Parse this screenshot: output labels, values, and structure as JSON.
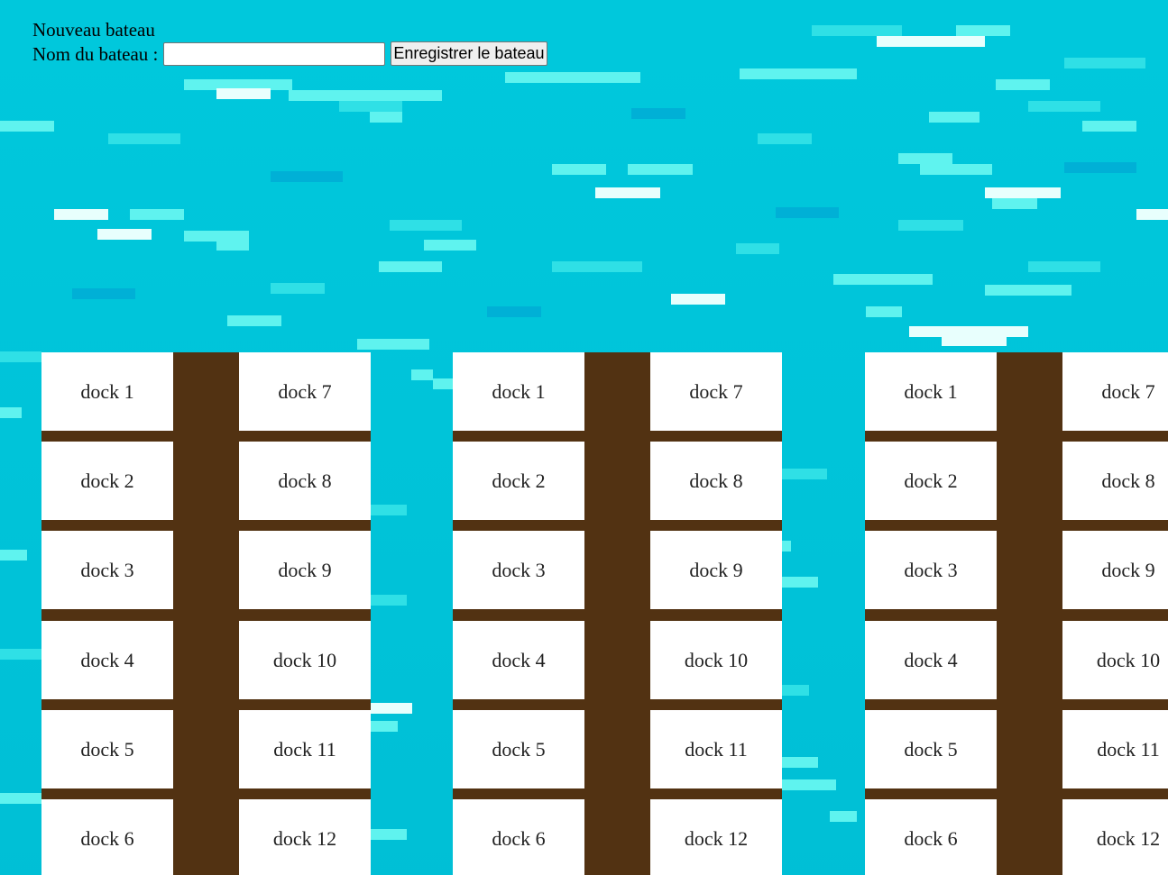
{
  "form": {
    "title": "Nouveau bateau",
    "label": "Nom du bateau :",
    "input_value": "",
    "button_label": "Enregistrer le bateau"
  },
  "piers": [
    {
      "left_docks": [
        "dock 1",
        "dock 2",
        "dock 3",
        "dock 4",
        "dock 5",
        "dock 6"
      ],
      "right_docks": [
        "dock 7",
        "dock 8",
        "dock 9",
        "dock 10",
        "dock 11",
        "dock 12"
      ]
    },
    {
      "left_docks": [
        "dock 1",
        "dock 2",
        "dock 3",
        "dock 4",
        "dock 5",
        "dock 6"
      ],
      "right_docks": [
        "dock 7",
        "dock 8",
        "dock 9",
        "dock 10",
        "dock 11",
        "dock 12"
      ]
    },
    {
      "left_docks": [
        "dock 1",
        "dock 2",
        "dock 3",
        "dock 4",
        "dock 5",
        "dock 6"
      ],
      "right_docks": [
        "dock 7",
        "dock 8",
        "dock 9",
        "dock 10",
        "dock 11",
        "dock 12"
      ]
    }
  ],
  "colors": {
    "water": "#00c3d7",
    "pier_wood": "#523212",
    "dock": "#ffffff"
  }
}
